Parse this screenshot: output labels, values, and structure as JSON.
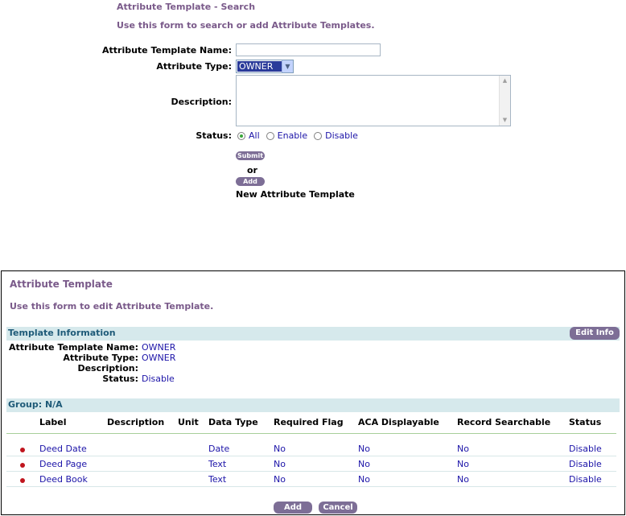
{
  "search_form": {
    "title": "Attribute Template - Search",
    "subtitle": "Use this form to search or add Attribute Templates.",
    "name_label": "Attribute Template Name:",
    "name_value": "",
    "type_label": "Attribute Type:",
    "type_value": "OWNER",
    "description_label": "Description:",
    "description_value": "",
    "status_label": "Status:",
    "status_options": [
      "All",
      "Enable",
      "Disable"
    ],
    "status_selected": "All",
    "submit_label": "Submit",
    "or_label": "or",
    "add_label": "Add",
    "new_template_label": "New Attribute Template"
  },
  "edit_panel": {
    "title": "Attribute Template",
    "subtitle": "Use this form to edit Attribute Template.",
    "section_label": "Template Information",
    "edit_info_label": "Edit Info",
    "info": {
      "name_label": "Attribute Template Name:",
      "name_value": "OWNER",
      "type_label": "Attribute Type:",
      "type_value": "OWNER",
      "description_label": "Description:",
      "description_value": "",
      "status_label": "Status:",
      "status_value": "Disable"
    },
    "group_label": "Group: N/A",
    "columns": [
      "Label",
      "Description",
      "Unit",
      "Data Type",
      "Required Flag",
      "ACA Displayable",
      "Record Searchable",
      "Status"
    ],
    "rows": [
      {
        "label": "Deed Date",
        "description": "",
        "unit": "",
        "data_type": "Date",
        "required": "No",
        "aca": "No",
        "searchable": "No",
        "status": "Disable"
      },
      {
        "label": "Deed Page",
        "description": "",
        "unit": "",
        "data_type": "Text",
        "required": "No",
        "aca": "No",
        "searchable": "No",
        "status": "Disable"
      },
      {
        "label": "Deed Book",
        "description": "",
        "unit": "",
        "data_type": "Text",
        "required": "No",
        "aca": "No",
        "searchable": "No",
        "status": "Disable"
      }
    ],
    "add_label": "Add",
    "cancel_label": "Cancel"
  },
  "colors": {
    "title_purple": "#7a5a8a",
    "link_blue": "#1c14a8",
    "button_purple": "#7d6e96",
    "section_bar": "#d6e9ec",
    "bullet_red": "#c0151e"
  }
}
